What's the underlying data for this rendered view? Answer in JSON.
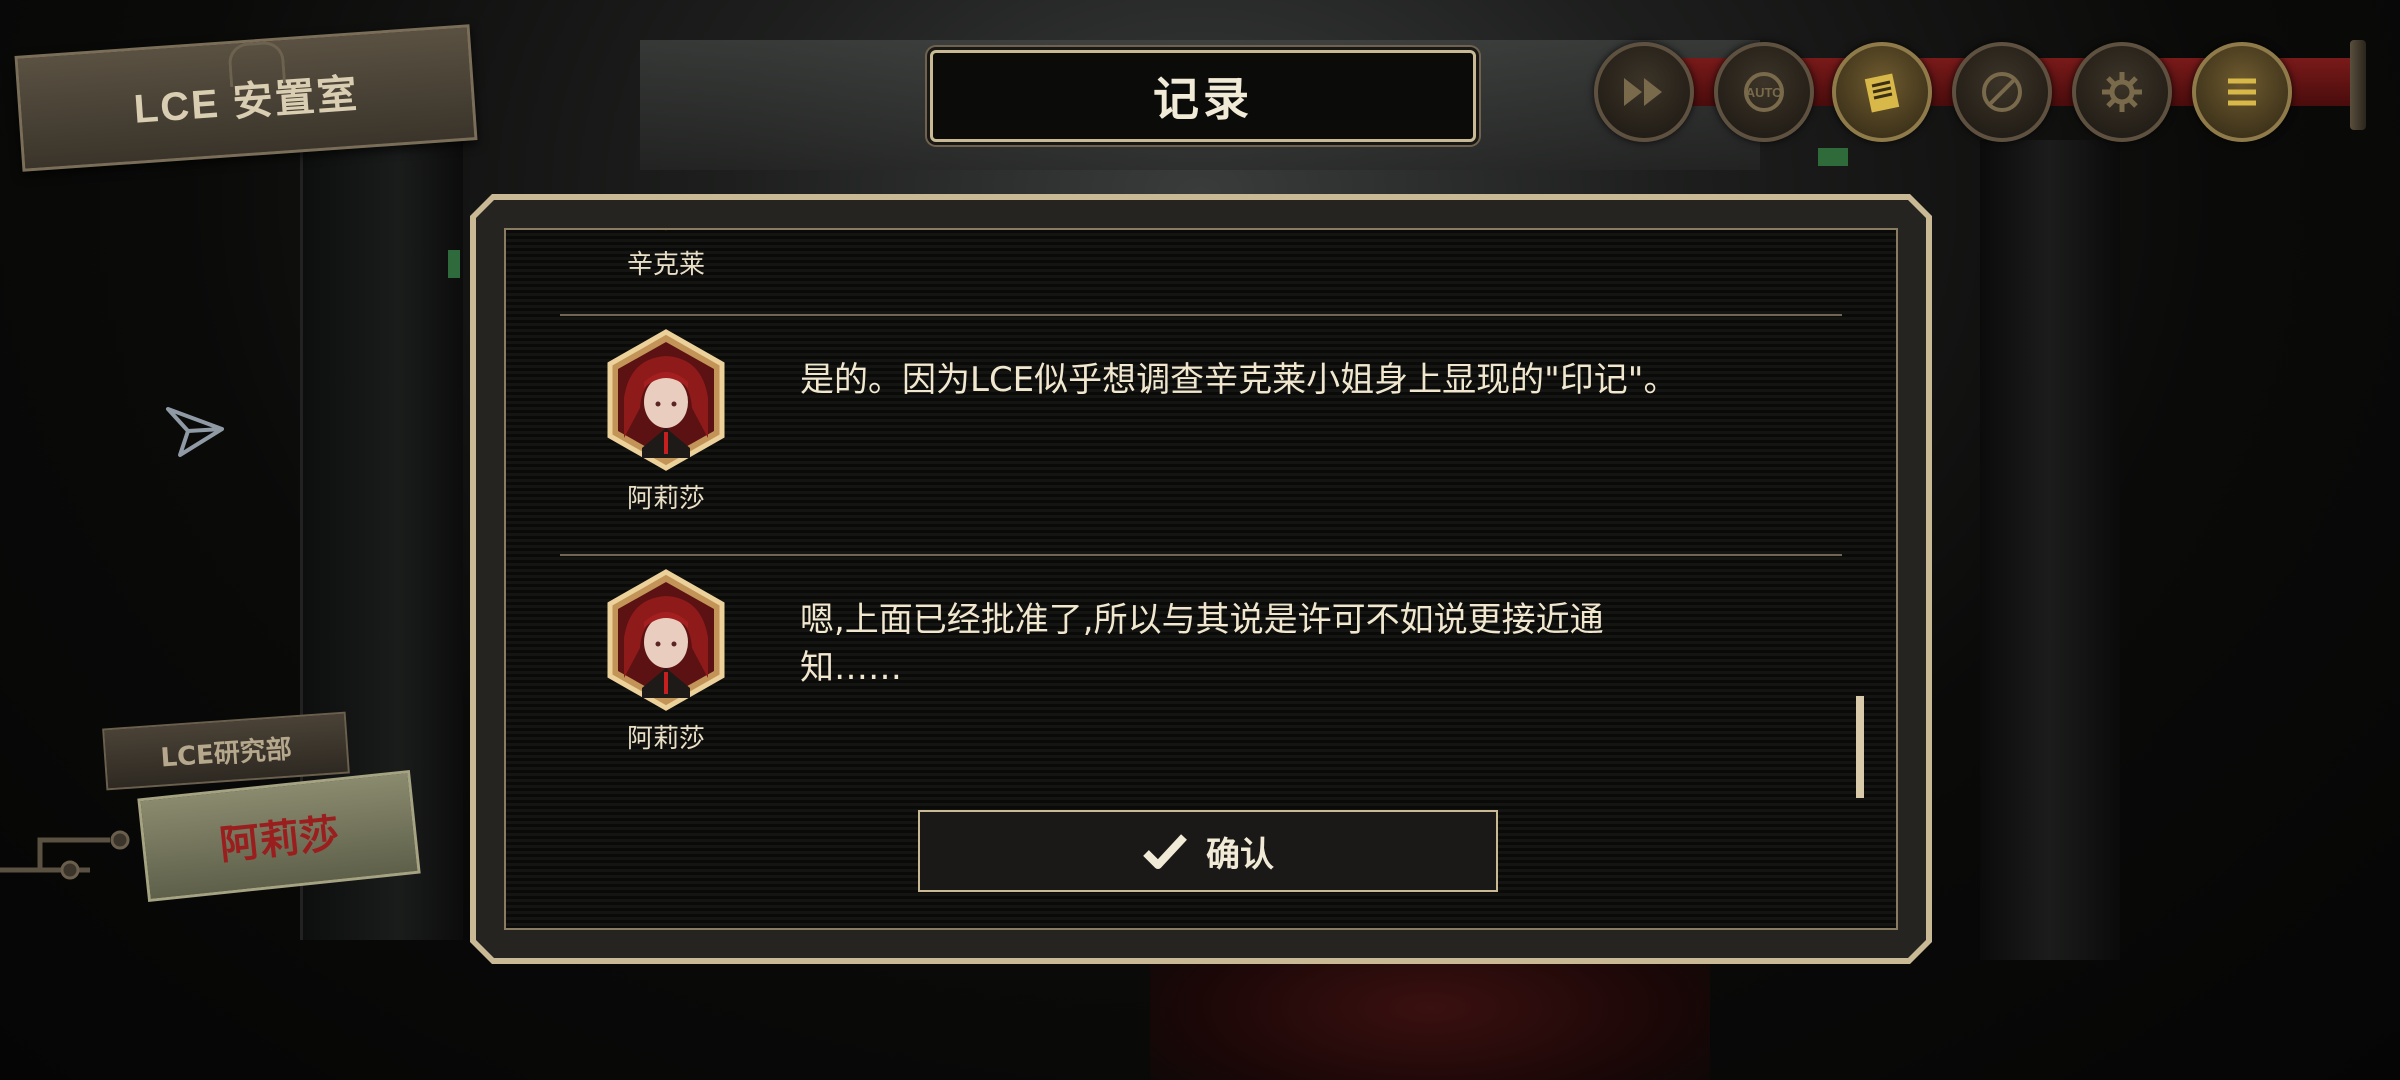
{
  "location": {
    "title": "LCE 安置室"
  },
  "toolbar": {
    "buttons": [
      {
        "icon": "fast-forward-icon",
        "label": "skip"
      },
      {
        "icon": "auto-icon",
        "label": "AUTO"
      },
      {
        "icon": "log-icon",
        "label": "log"
      },
      {
        "icon": "hide-ui-icon",
        "label": "hide"
      },
      {
        "icon": "gear-icon",
        "label": "settings"
      },
      {
        "icon": "menu-icon",
        "label": "menu"
      }
    ]
  },
  "dialog": {
    "title": "记录",
    "entries": [
      {
        "speaker": "辛克莱",
        "text": ""
      },
      {
        "speaker": "阿莉莎",
        "text": "是的。因为LCE似乎想调查辛克莱小姐身上显现的\"印记\"。"
      },
      {
        "speaker": "阿莉莎",
        "text": "嗯,上面已经批准了,所以与其说是许可不如说更接近通知……"
      }
    ],
    "confirm_label": "确认"
  },
  "speaker_tag": {
    "department": "LCE研究部",
    "name": "阿莉莎"
  },
  "colors": {
    "frame": "#c9b994",
    "accent_red": "#7a1a1a",
    "text": "#f1e7cf"
  }
}
